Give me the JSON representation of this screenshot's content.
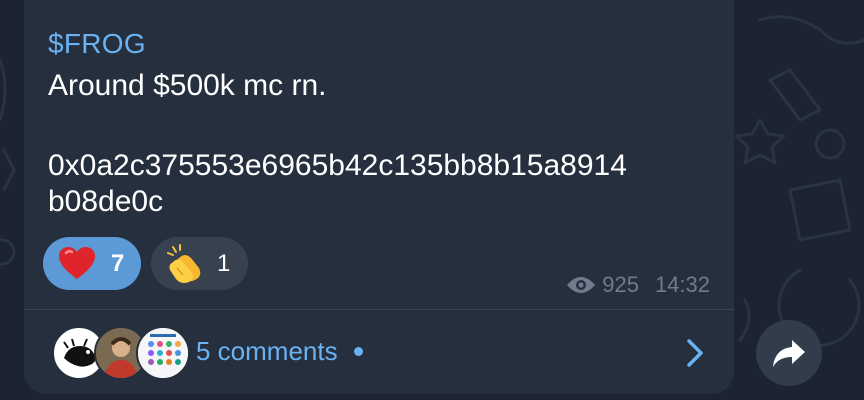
{
  "message": {
    "tag": "$FROG",
    "lines": [
      "Around $500k mc rn.",
      "0x0a2c375553e6965b42c135bb8b15a8914",
      "b08de0c"
    ]
  },
  "reactions": [
    {
      "emoji": "heart",
      "count": "7",
      "active": true
    },
    {
      "emoji": "clapping-hands",
      "count": "1",
      "active": false
    }
  ],
  "meta": {
    "views": "925",
    "time": "14:32"
  },
  "comments": {
    "label": "5 comments",
    "unread": true
  },
  "colors": {
    "background": "#1c2432",
    "bubble": "#252f3d",
    "accent": "#6ab2f2",
    "reaction_active": "#5b9ad6",
    "reaction_inactive": "#38424f",
    "meta_text": "#6f7c8c"
  },
  "icons": {
    "views": "eye-icon",
    "open_comments": "chevron-right-icon",
    "forward": "share-arrow-icon"
  }
}
